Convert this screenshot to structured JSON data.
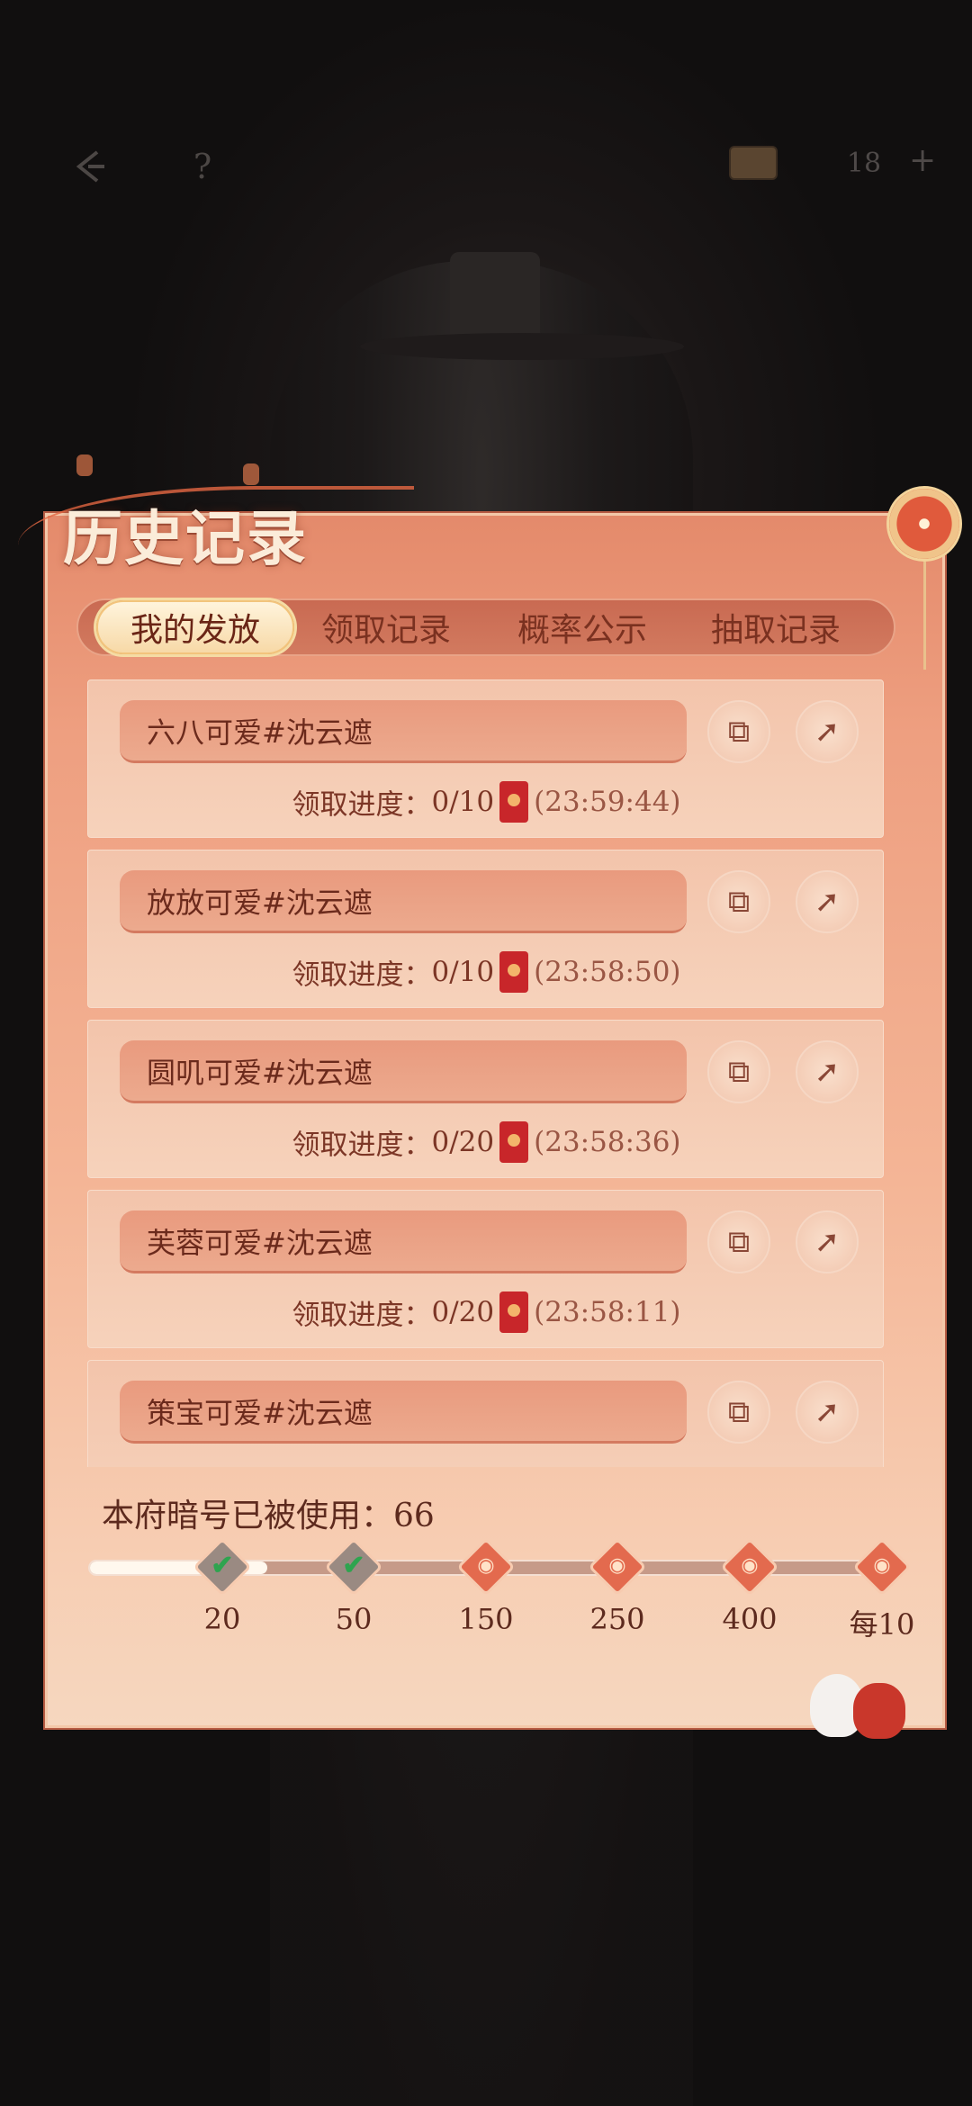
{
  "topbar": {
    "back_icon": "back-arrow-icon",
    "help_label": "?",
    "currency_icon": "chest-icon",
    "currency_value": "18",
    "add_label": "+"
  },
  "panel": {
    "title": "历史记录"
  },
  "tabs": [
    {
      "label": "我的发放",
      "active": true
    },
    {
      "label": "领取记录",
      "active": false
    },
    {
      "label": "概率公示",
      "active": false
    },
    {
      "label": "抽取记录",
      "active": false
    }
  ],
  "records": [
    {
      "name": "六八可爱#沈云遮",
      "progress_label": "领取进度：",
      "progress": "0/10",
      "timer": "(23:59:44)"
    },
    {
      "name": "放放可爱#沈云遮",
      "progress_label": "领取进度：",
      "progress": "0/10",
      "timer": "(23:58:50)"
    },
    {
      "name": "圆叽可爱#沈云遮",
      "progress_label": "领取进度：",
      "progress": "0/20",
      "timer": "(23:58:36)"
    },
    {
      "name": "芙蓉可爱#沈云遮",
      "progress_label": "领取进度：",
      "progress": "0/20",
      "timer": "(23:58:11)"
    },
    {
      "name": "策宝可爱#沈云遮",
      "progress_label": "",
      "progress": "",
      "timer": ""
    }
  ],
  "usage": {
    "label": "本府暗号已被使用：66",
    "count": 66,
    "progress_fraction": 0.22,
    "milestones": [
      {
        "label": "20",
        "claimed": true
      },
      {
        "label": "50",
        "claimed": true
      },
      {
        "label": "150",
        "claimed": false
      },
      {
        "label": "250",
        "claimed": false
      },
      {
        "label": "400",
        "claimed": false
      },
      {
        "label": "每10",
        "claimed": false
      }
    ]
  },
  "colors": {
    "accent": "#e36a4e",
    "panel_top": "#e48a6b",
    "panel_bottom": "#f6d7bf",
    "check": "#2ea44f"
  }
}
